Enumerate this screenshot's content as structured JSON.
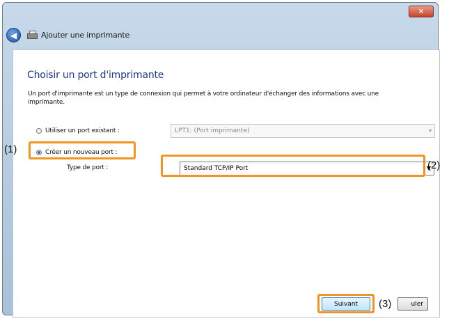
{
  "window": {
    "close_glyph": "✕",
    "back_glyph": "◀",
    "title": "Ajouter une imprimante"
  },
  "page": {
    "heading": "Choisir un port d'imprimante",
    "description": "Un port d'imprimante est un type de connexion qui permet à votre ordinateur d'échanger des informations avec une imprimante."
  },
  "options": {
    "existing_label": "Utiliser un port existant :",
    "existing_value": "LPT1: (Port imprimante)",
    "new_label": "Créer un nouveau port :",
    "port_type_label": "Type de port :",
    "port_type_value": "Standard TCP/IP Port",
    "selected": "new"
  },
  "buttons": {
    "next": "Suivant",
    "cancel_partial": "uler"
  },
  "callouts": {
    "c1": "(1)",
    "c2": "(2)",
    "c3": "(3)"
  },
  "colors": {
    "highlight": "#f39321",
    "heading": "#1d3a8a"
  }
}
